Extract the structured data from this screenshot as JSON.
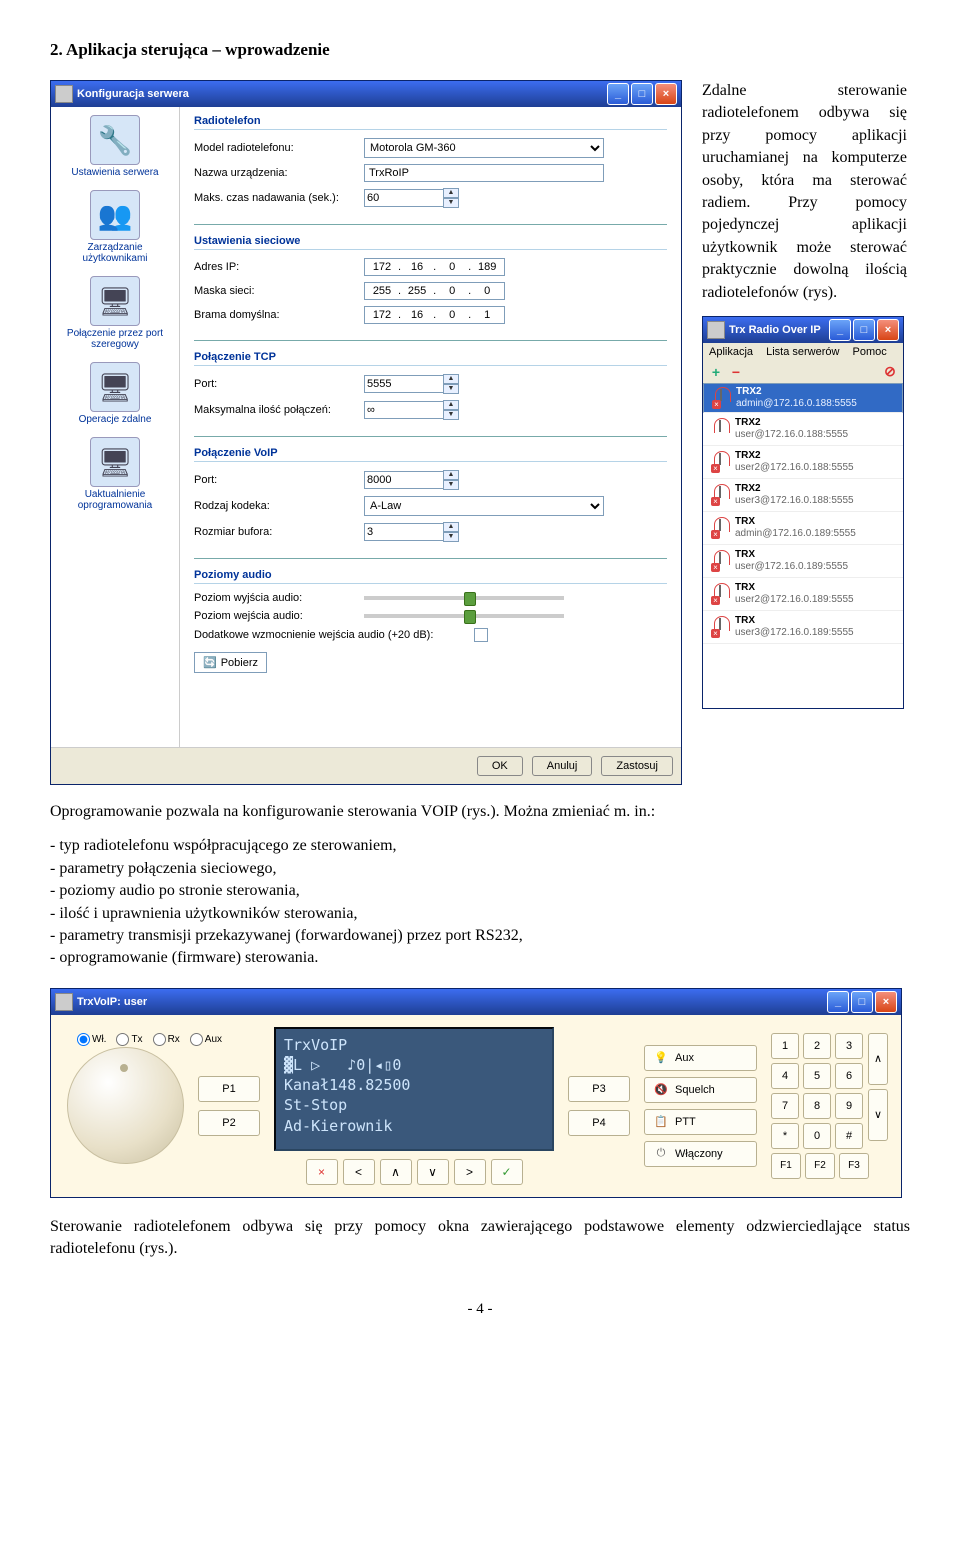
{
  "section_title": "2.     Aplikacja sterująca – wprowadzenie",
  "intro": "Zdalne sterowanie radiotelefonem odbywa się przy pomocy aplikacji uruchamianej na komputerze osoby, która ma sterować radiem. Przy pomocy pojedynczej aplikacji użytkownik może sterować praktycznie dowolną ilością radiotelefonów (rys).",
  "para2": "Oprogramowanie pozwala na konfigurowanie sterowania VOIP (rys.). Można zmieniać m. in.:",
  "bullets": [
    "- typ radiotelefonu współpracującego ze sterowaniem,",
    "- parametry połączenia sieciowego,",
    "- poziomy audio po stronie sterowania,",
    "- ilość i uprawnienia użytkowników sterowania,",
    "- parametry transmisji przekazywanej (forwardowanej) przez port RS232,",
    "- oprogramowanie (firmware) sterowania."
  ],
  "para3": "Sterowanie radiotelefonem odbywa się przy pomocy okna zawierającego podstawowe elementy odzwierciedlające status radiotelefonu (rys.).",
  "footer": "- 4 -",
  "cfg": {
    "title": "Konfiguracja serwera",
    "side": [
      {
        "label": "Ustawienia serwera",
        "icon": "🔧"
      },
      {
        "label": "Zarządzanie użytkownikami",
        "icon": "👥"
      },
      {
        "label": "Połączenie przez port szeregowy",
        "icon": "🖥"
      },
      {
        "label": "Operacje zdalne",
        "icon": "🖥"
      },
      {
        "label": "Uaktualnienie oprogramowania",
        "icon": "🖥"
      }
    ],
    "groups": {
      "radio": {
        "title": "Radiotelefon",
        "model_l": "Model radiotelefonu:",
        "model_v": "Motorola GM-360",
        "name_l": "Nazwa urządzenia:",
        "name_v": "TrxRoIP",
        "tx_l": "Maks. czas nadawania (sek.):",
        "tx_v": "60"
      },
      "net": {
        "title": "Ustawienia sieciowe",
        "ip_l": "Adres IP:",
        "ip": [
          "172",
          "16",
          "0",
          "189"
        ],
        "mask_l": "Maska sieci:",
        "mask": [
          "255",
          "255",
          "0",
          "0"
        ],
        "gw_l": "Brama domyślna:",
        "gw": [
          "172",
          "16",
          "0",
          "1"
        ]
      },
      "tcp": {
        "title": "Połączenie TCP",
        "port_l": "Port:",
        "port_v": "5555",
        "max_l": "Maksymalna ilość połączeń:",
        "max_v": "∞"
      },
      "voip": {
        "title": "Połączenie VoIP",
        "port_l": "Port:",
        "port_v": "8000",
        "codec_l": "Rodzaj kodeka:",
        "codec_v": "A-Law",
        "buf_l": "Rozmiar bufora:",
        "buf_v": "3"
      },
      "audio": {
        "title": "Poziomy audio",
        "out_l": "Poziom wyjścia audio:",
        "in_l": "Poziom wejścia audio:",
        "gain_l": "Dodatkowe wzmocnienie wejścia audio (+20 dB):"
      }
    },
    "pobierz": "Pobierz",
    "ok": "OK",
    "cancel": "Anuluj",
    "apply": "Zastosuj"
  },
  "trx": {
    "title": "Trx Radio Over IP",
    "menu": [
      "Aplikacja",
      "Lista serwerów",
      "Pomoc"
    ],
    "servers": [
      {
        "name": "TRX2",
        "addr": "admin@172.16.0.188:5555",
        "x": true
      },
      {
        "name": "TRX2",
        "addr": "user@172.16.0.188:5555",
        "x": false
      },
      {
        "name": "TRX2",
        "addr": "user2@172.16.0.188:5555",
        "x": true
      },
      {
        "name": "TRX2",
        "addr": "user3@172.16.0.188:5555",
        "x": true
      },
      {
        "name": "TRX",
        "addr": "admin@172.16.0.189:5555",
        "x": true
      },
      {
        "name": "TRX",
        "addr": "user@172.16.0.189:5555",
        "x": true
      },
      {
        "name": "TRX",
        "addr": "user2@172.16.0.189:5555",
        "x": true
      },
      {
        "name": "TRX",
        "addr": "user3@172.16.0.189:5555",
        "x": true
      }
    ]
  },
  "voip": {
    "title": "TrxVoIP: user",
    "radio": [
      "Wł.",
      "Tx",
      "Rx",
      "Aux"
    ],
    "p": [
      "P1",
      "P2",
      "P3",
      "P4"
    ],
    "lcd": [
      "TrxVoIP",
      "▓L ▷   ♪0|◂▯0",
      "Kanał148.82500",
      "St-Stop",
      "Ad-Kierownik"
    ],
    "right": [
      {
        "i": "💡",
        "l": "Aux"
      },
      {
        "i": "🔇",
        "l": "Squelch"
      },
      {
        "i": "📋",
        "l": "PTT"
      },
      {
        "i": "⏻",
        "l": "Włączony"
      }
    ],
    "keys": [
      "1",
      "2",
      "3",
      "4",
      "5",
      "6",
      "7",
      "8",
      "9",
      "*",
      "0",
      "#"
    ],
    "fkeys": [
      "F1",
      "F2",
      "F3"
    ],
    "nav": [
      "×",
      "<",
      "∧",
      "∨",
      ">",
      "✓"
    ]
  }
}
